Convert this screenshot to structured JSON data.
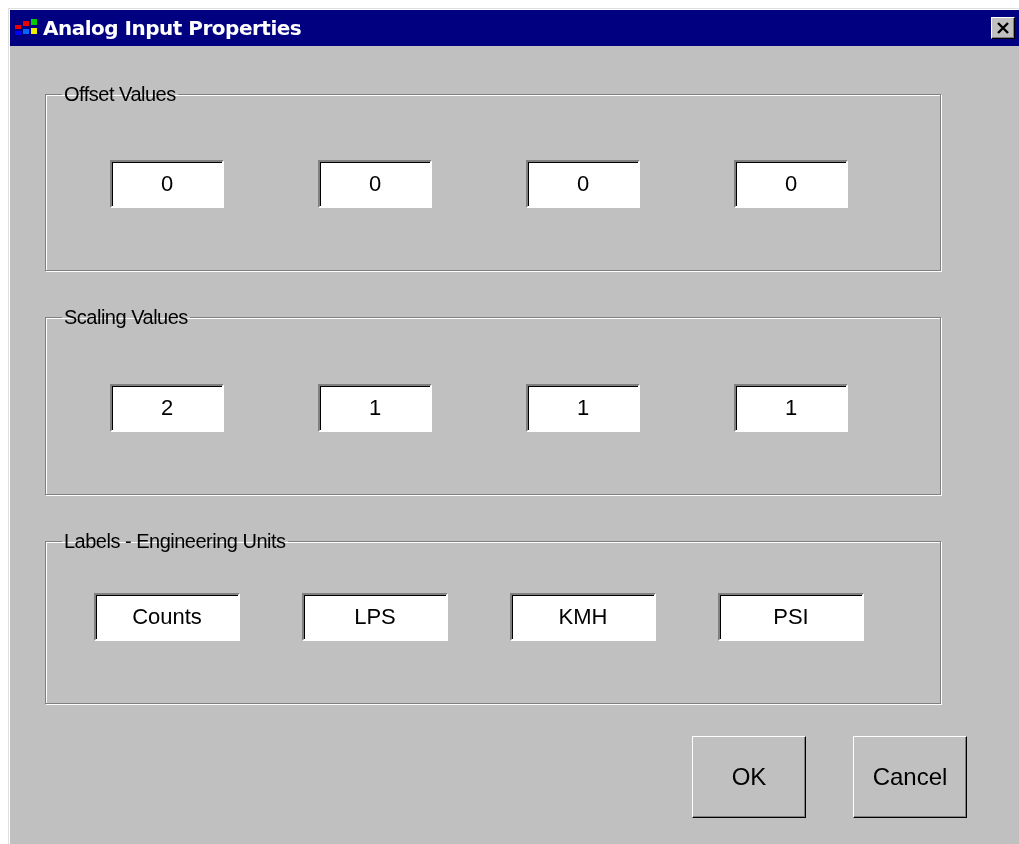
{
  "window": {
    "title": "Analog Input Properties"
  },
  "groups": [
    {
      "title": "Offset Values",
      "kind": "numeric",
      "fields": [
        "0",
        "0",
        "0",
        "0"
      ]
    },
    {
      "title": "Scaling Values",
      "kind": "numeric",
      "fields": [
        "2",
        "1",
        "1",
        "1"
      ]
    },
    {
      "title": "Labels - Engineering Units",
      "kind": "label",
      "fields": [
        "Counts",
        "LPS",
        "KMH",
        "PSI"
      ]
    }
  ],
  "buttons": [
    "OK",
    "Cancel"
  ]
}
